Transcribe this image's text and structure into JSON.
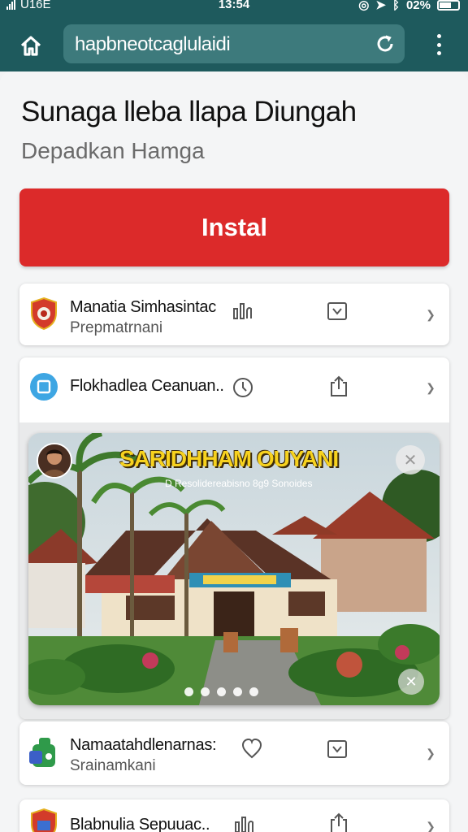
{
  "status_bar": {
    "carrier": "U16E",
    "time": "13:54",
    "battery": "02%"
  },
  "browser": {
    "url": "hapbneotcaglulaidi"
  },
  "page": {
    "title": "Sunaga lleba llapa Diungah",
    "subtitle": "Depadkan Hamga",
    "install_label": "Instal"
  },
  "apps": [
    {
      "name": "Manatia Simhasintac",
      "subtitle": "Prepmatrnani"
    },
    {
      "name": "Flokhadlea Ceanuan..",
      "subtitle": ""
    },
    {
      "name": "Namaatahdlenarnas:",
      "subtitle": "Srainamkani"
    },
    {
      "name": "Blabnulia Sepuuac..",
      "subtitle": ""
    }
  ],
  "banner": {
    "title": "SARIDHHAM OUYANI",
    "subtitle": "D Resolidereabisno 8g9 Sonoides",
    "slide_count": 5,
    "active_slide": 1
  },
  "colors": {
    "toolbar": "#1e5a5d",
    "install": "#dc2a2a"
  }
}
